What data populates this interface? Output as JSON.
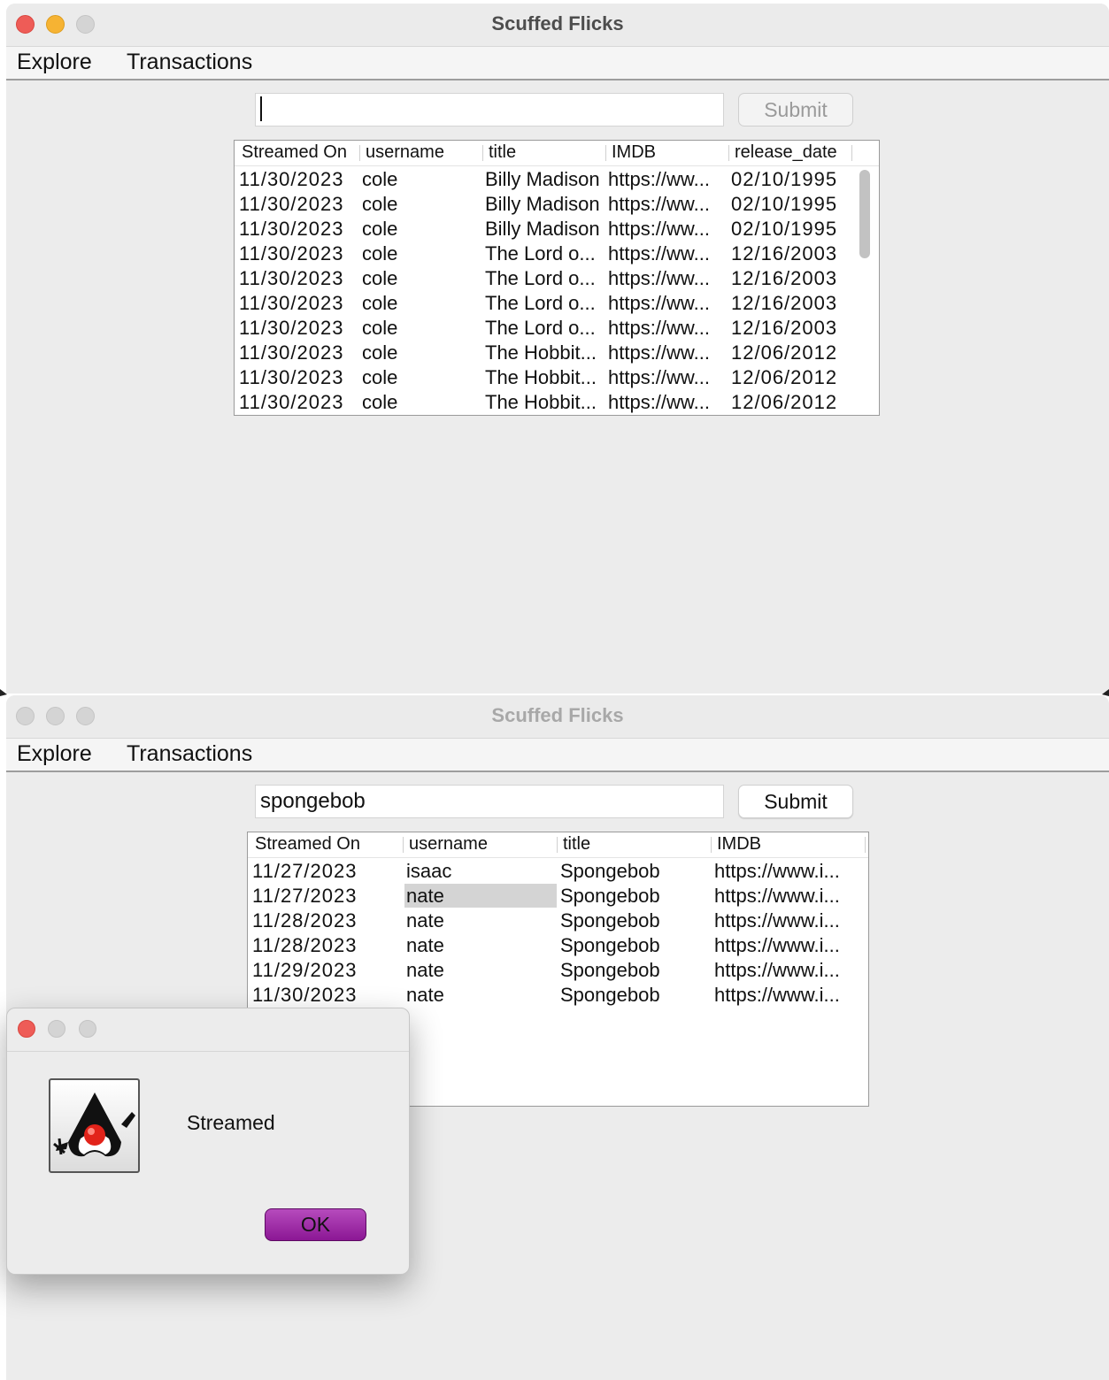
{
  "accent_colors": {
    "ok_button": "#9b22a3",
    "close_light": "#ee5c57",
    "minimize_light": "#f6b333"
  },
  "window1": {
    "title": "Scuffed Flicks",
    "menu": [
      "Explore",
      "Transactions"
    ],
    "search": {
      "value": ""
    },
    "submit_label": "Submit",
    "table": {
      "columns": [
        "Streamed On",
        "username",
        "title",
        "IMDB",
        "release_date"
      ],
      "rows": [
        [
          "11/30/2023",
          "cole",
          "Billy Madison",
          "https://ww...",
          "02/10/1995"
        ],
        [
          "11/30/2023",
          "cole",
          "Billy Madison",
          "https://ww...",
          "02/10/1995"
        ],
        [
          "11/30/2023",
          "cole",
          "Billy Madison",
          "https://ww...",
          "02/10/1995"
        ],
        [
          "11/30/2023",
          "cole",
          "The Lord o...",
          "https://ww...",
          "12/16/2003"
        ],
        [
          "11/30/2023",
          "cole",
          "The Lord o...",
          "https://ww...",
          "12/16/2003"
        ],
        [
          "11/30/2023",
          "cole",
          "The Lord o...",
          "https://ww...",
          "12/16/2003"
        ],
        [
          "11/30/2023",
          "cole",
          "The Lord o...",
          "https://ww...",
          "12/16/2003"
        ],
        [
          "11/30/2023",
          "cole",
          "The Hobbit...",
          "https://ww...",
          "12/06/2012"
        ],
        [
          "11/30/2023",
          "cole",
          "The Hobbit...",
          "https://ww...",
          "12/06/2012"
        ],
        [
          "11/30/2023",
          "cole",
          "The Hobbit...",
          "https://ww...",
          "12/06/2012"
        ]
      ]
    }
  },
  "window2": {
    "title": "Scuffed Flicks",
    "menu": [
      "Explore",
      "Transactions"
    ],
    "search": {
      "value": "spongebob"
    },
    "submit_label": "Submit",
    "table": {
      "columns": [
        "Streamed On",
        "username",
        "title",
        "IMDB"
      ],
      "rows": [
        [
          "11/27/2023",
          "isaac",
          "Spongebob",
          "https://www.i..."
        ],
        [
          "11/27/2023",
          "nate",
          "Spongebob",
          "https://www.i..."
        ],
        [
          "11/28/2023",
          "nate",
          "Spongebob",
          "https://www.i..."
        ],
        [
          "11/28/2023",
          "nate",
          "Spongebob",
          "https://www.i..."
        ],
        [
          "11/29/2023",
          "nate",
          "Spongebob",
          "https://www.i..."
        ],
        [
          "11/30/2023",
          "nate",
          "Spongebob",
          "https://www.i..."
        ]
      ]
    }
  },
  "dialog": {
    "icon": "java-duke-icon",
    "message": "Streamed",
    "ok_label": "OK"
  }
}
